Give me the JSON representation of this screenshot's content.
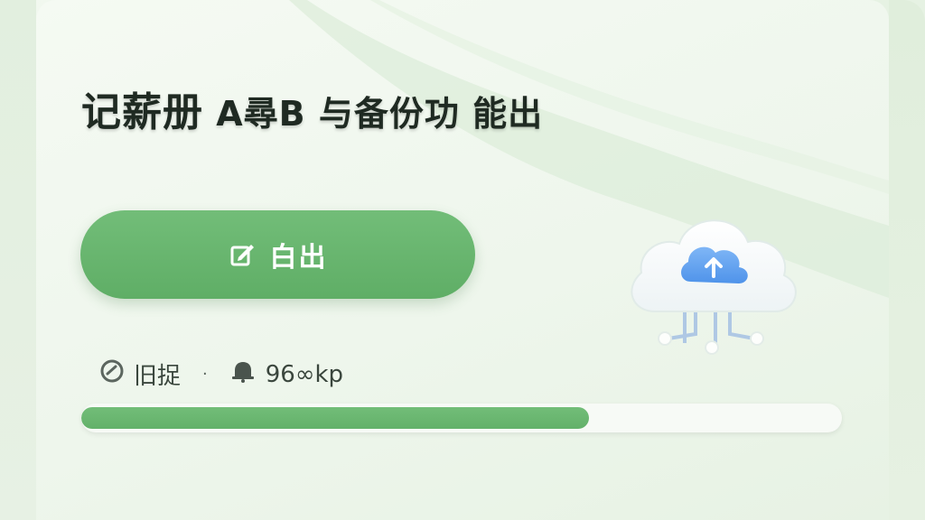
{
  "title": {
    "part1": "记薪册",
    "part2": "A尋B 与备份功 能出"
  },
  "action_button": {
    "label": "白出",
    "icon": "edit-icon"
  },
  "cloud": {
    "icon": "cloud-upload-icon"
  },
  "status": {
    "status_icon": "check-circle-icon",
    "label": "旧捉",
    "separator": "·",
    "second_icon": "bell-icon",
    "size_text": "96∞kp"
  },
  "progress": {
    "fraction": 0.667
  },
  "colors": {
    "accent": "#66b36d",
    "cloud_blue": "#5c9ef0",
    "background": "#eaf4e8"
  }
}
